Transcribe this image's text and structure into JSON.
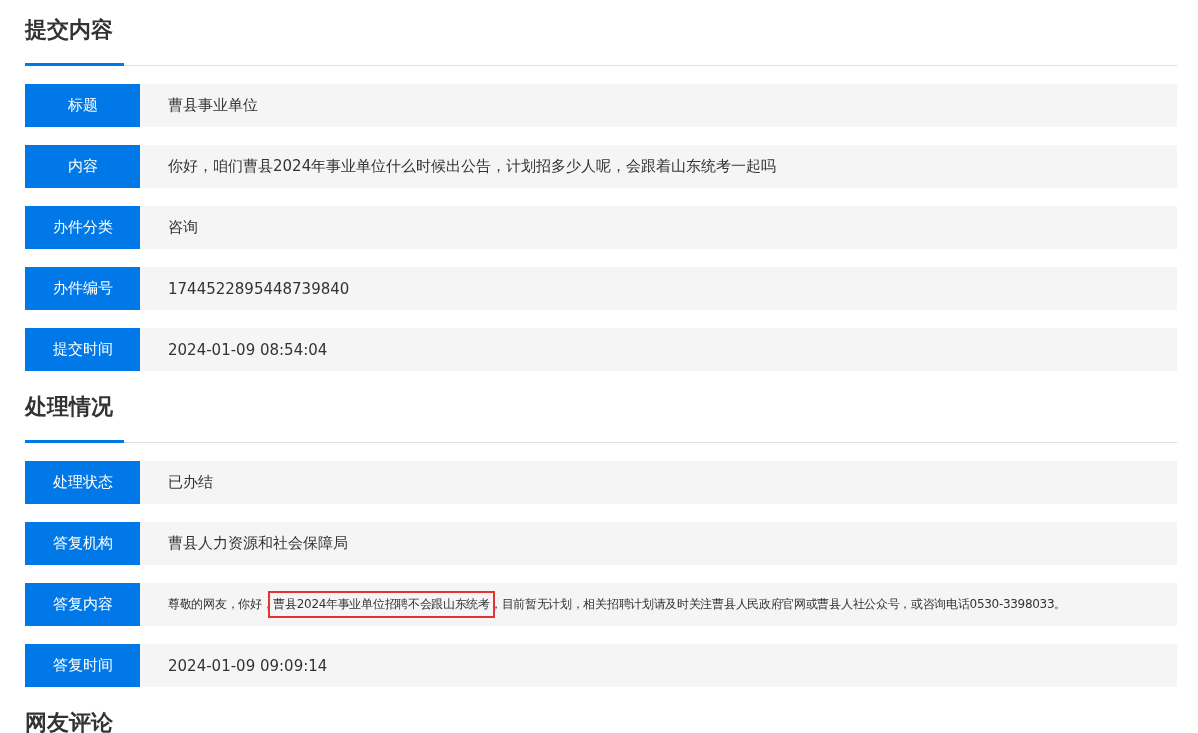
{
  "sections": [
    {
      "title": "提交内容",
      "rows": [
        {
          "label": "标题",
          "value": "曹县事业单位"
        },
        {
          "label": "内容",
          "value": "你好，咱们曹县2024年事业单位什么时候出公告，计划招多少人呢，会跟着山东统考一起吗"
        },
        {
          "label": "办件分类",
          "value": "咨询"
        },
        {
          "label": "办件编号",
          "value": "1744522895448739840"
        },
        {
          "label": "提交时间",
          "value": "2024-01-09 08:54:04"
        }
      ]
    },
    {
      "title": "处理情况",
      "rows": [
        {
          "label": "处理状态",
          "value": "已办结"
        },
        {
          "label": "答复机构",
          "value": "曹县人力资源和社会保障局"
        },
        {
          "label": "答复内容",
          "kind": "segments",
          "segments": [
            {
              "text": "尊敬的网友，你好，",
              "highlighted": false
            },
            {
              "text": "曹县2024年事业单位招聘不会跟山东统考",
              "highlighted": true
            },
            {
              "text": "，目前暂无计划，相关招聘计划请及时关注曹县人民政府官网或曹县人社公众号，或咨询电话0530-3398033。",
              "highlighted": false
            }
          ]
        },
        {
          "label": "答复时间",
          "value": "2024-01-09 09:09:14"
        }
      ]
    },
    {
      "title": "网友评论"
    }
  ]
}
